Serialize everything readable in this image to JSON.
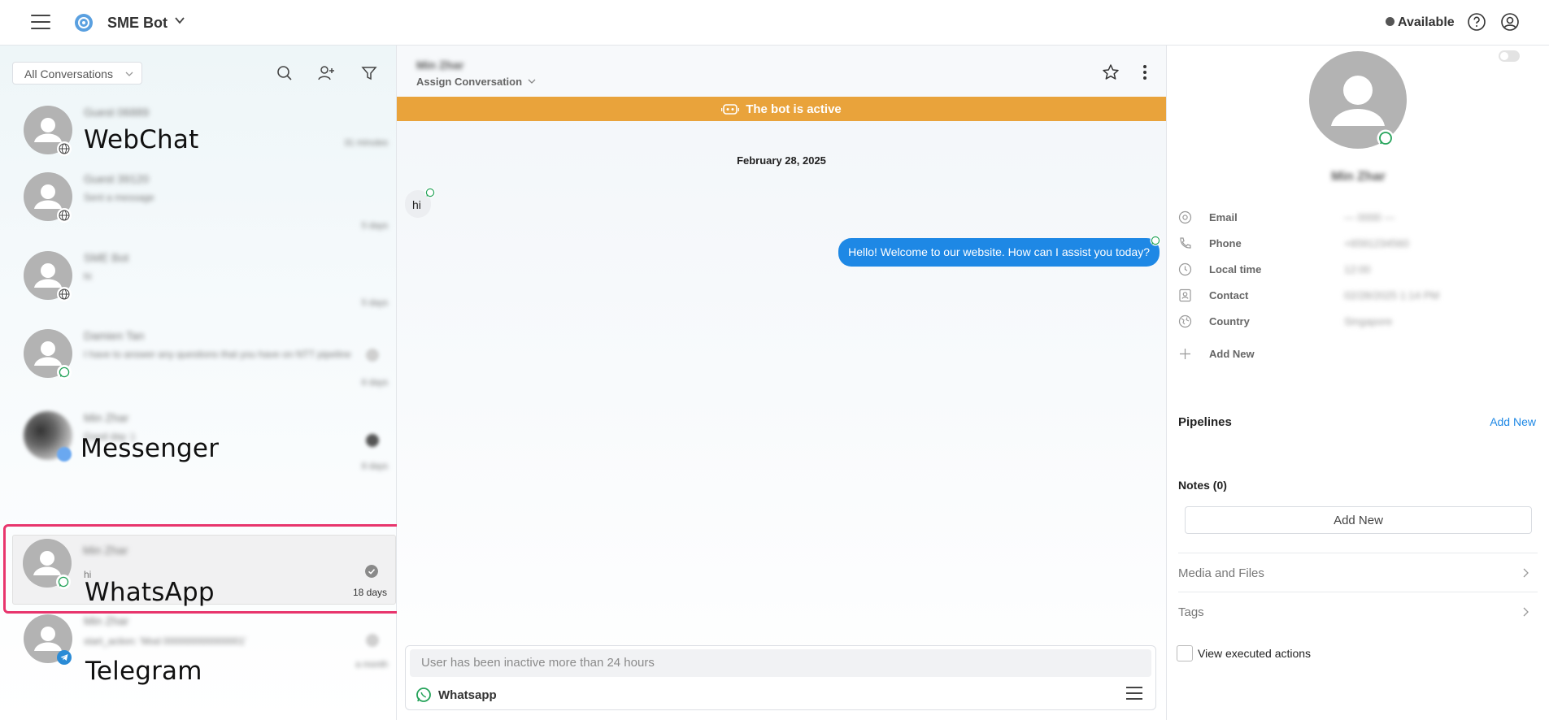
{
  "topbar": {
    "app_name": "SME Bot",
    "status": "Available"
  },
  "left_panel": {
    "filter_value": "All Conversations",
    "conversations": [
      {
        "name": "Guest 06889",
        "preview": "",
        "time": "31 minutes",
        "channel": "webchat",
        "channel_label": "WebChat"
      },
      {
        "name": "Guest 39120",
        "preview": "Sent a message",
        "time": "5 days",
        "channel": "webchat",
        "channel_label": ""
      },
      {
        "name": "SME Bot",
        "preview": "hi",
        "time": "5 days",
        "channel": "webchat",
        "channel_label": ""
      },
      {
        "name": "Damien Tan",
        "preview": "I have to answer any questions that you have on NTT pipeline",
        "time": "6 days",
        "channel": "whatsapp",
        "channel_label": ""
      },
      {
        "name": "Min Zhar",
        "preview": "Good day :)",
        "time": "8 days",
        "channel": "messenger",
        "channel_label": "Messenger"
      },
      {
        "name": "Min Zhar",
        "preview": "hi",
        "time": "18 days",
        "channel": "whatsapp",
        "channel_label": "WhatsApp"
      },
      {
        "name": "Min Zhar",
        "preview": "start_action: 'Mod 000000000000001'",
        "time": "a month",
        "channel": "telegram",
        "channel_label": "Telegram"
      }
    ]
  },
  "chat": {
    "contact_name": "Min Zhar",
    "assign_label": "Assign Conversation",
    "bot_banner": "The bot is active",
    "date_separator": "February 28, 2025",
    "incoming_message": "hi",
    "outgoing_message": "Hello! Welcome to our website. How can I assist you today?",
    "composer_placeholder": "User has been inactive more than 24 hours",
    "composer_channel": "Whatsapp"
  },
  "contact_panel": {
    "name": "Min Zhar",
    "fields": [
      {
        "label": "Email",
        "value": "— 0000 —",
        "icon": "at-icon"
      },
      {
        "label": "Phone",
        "value": "+6591234560",
        "icon": "phone-icon"
      },
      {
        "label": "Local time",
        "value": "12:00",
        "icon": "clock-icon"
      },
      {
        "label": "Contact",
        "value": "02/28/2025 1:14 PM",
        "icon": "contact-card-icon"
      },
      {
        "label": "Country",
        "value": "Singapore",
        "icon": "globe-icon"
      }
    ],
    "add_new_field": "Add New",
    "pipelines_title": "Pipelines",
    "pipelines_add": "Add New",
    "notes_title": "Notes (0)",
    "notes_add": "Add New",
    "media_files": "Media and Files",
    "tags": "Tags",
    "view_actions": "View executed actions"
  },
  "colors": {
    "banner": "#e9a33b",
    "outgoing_bubble": "#1e88e5",
    "highlight": "#e8356d",
    "whatsapp": "#25a35a",
    "telegram": "#2a8bd6"
  }
}
